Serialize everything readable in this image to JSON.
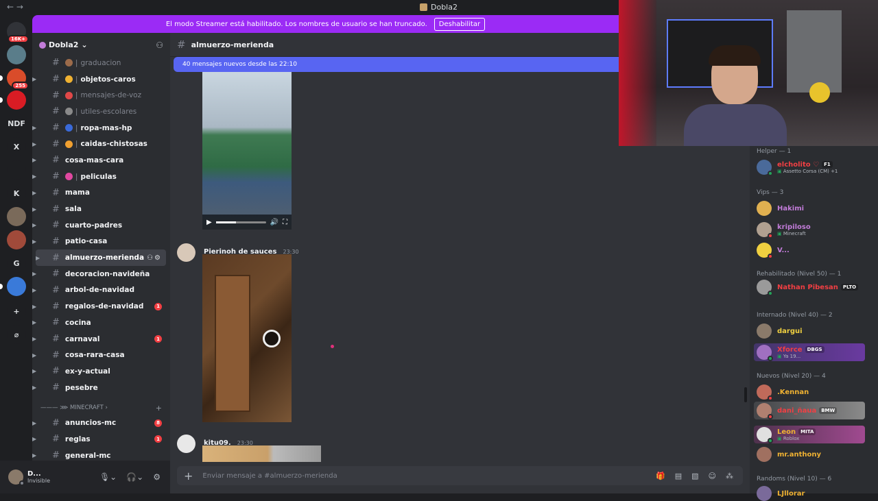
{
  "window": {
    "title": "Dobla2",
    "nav": "←  →"
  },
  "streamer_banner": {
    "text": "El modo Streamer está habilitado. Los nombres de usuario se han truncado.",
    "button": "Deshabilitar"
  },
  "servers": [
    {
      "label": "",
      "badge": "16K+",
      "color": "#313338"
    },
    {
      "label": "",
      "badge": "",
      "color": "#5a7d8a"
    },
    {
      "label": "",
      "badge": "255",
      "color": "#d94c2a"
    },
    {
      "label": "",
      "badge": "",
      "color": "#d91c24"
    },
    {
      "label": "NDF",
      "badge": "",
      "color": "#1e1f22"
    },
    {
      "label": "X",
      "badge": "",
      "color": "#1e1f22"
    },
    {
      "label": "",
      "badge": "",
      "color": "#1e1f22"
    },
    {
      "label": "K",
      "badge": "",
      "color": "#1e1f22"
    },
    {
      "label": "",
      "badge": "",
      "color": "#7a6a5a"
    },
    {
      "label": "",
      "badge": "",
      "color": "#a04a3a"
    },
    {
      "label": "G",
      "badge": "",
      "color": "#1e1f22"
    },
    {
      "label": "",
      "badge": "",
      "color": "#3a7ad9"
    },
    {
      "label": "+",
      "badge": "",
      "color": "#1e1f22"
    },
    {
      "label": "⌀",
      "badge": "",
      "color": "#1e1f22"
    }
  ],
  "guild": {
    "name": "Dobla2"
  },
  "channels": [
    {
      "name": "graduacion",
      "emoji_color": "#9c6b4a",
      "sep": true,
      "muted": true,
      "arrow": false,
      "unread": ""
    },
    {
      "name": "objetos-caros",
      "emoji_color": "#f0b232",
      "sep": true,
      "muted": false,
      "arrow": true,
      "unread": ""
    },
    {
      "name": "mensajes-de-voz",
      "emoji_color": "#e04848",
      "sep": true,
      "muted": true,
      "arrow": false,
      "unread": ""
    },
    {
      "name": "utiles-escolares",
      "emoji_color": "#8a8a8a",
      "sep": true,
      "muted": true,
      "arrow": false,
      "unread": ""
    },
    {
      "name": "ropa-mas-hp",
      "emoji_color": "#3a6ad9",
      "sep": true,
      "muted": false,
      "arrow": true,
      "unread": ""
    },
    {
      "name": "caidas-chistosas",
      "emoji_color": "#f0a030",
      "sep": true,
      "muted": false,
      "arrow": true,
      "unread": ""
    },
    {
      "name": "cosa-mas-cara",
      "emoji_color": "",
      "sep": false,
      "muted": false,
      "arrow": true,
      "unread": ""
    },
    {
      "name": "peliculas",
      "emoji_color": "#e048a0",
      "sep": true,
      "muted": false,
      "arrow": true,
      "unread": ""
    },
    {
      "name": "mama",
      "emoji_color": "",
      "sep": false,
      "muted": false,
      "arrow": true,
      "unread": ""
    },
    {
      "name": "sala",
      "emoji_color": "",
      "sep": false,
      "muted": false,
      "arrow": true,
      "unread": ""
    },
    {
      "name": "cuarto-padres",
      "emoji_color": "",
      "sep": false,
      "muted": false,
      "arrow": true,
      "unread": ""
    },
    {
      "name": "patio-casa",
      "emoji_color": "",
      "sep": false,
      "muted": false,
      "arrow": true,
      "unread": ""
    },
    {
      "name": "almuerzo-merienda",
      "emoji_color": "",
      "sep": false,
      "muted": false,
      "arrow": true,
      "unread": "",
      "active": true
    },
    {
      "name": "decoracion-navideña",
      "emoji_color": "",
      "sep": false,
      "muted": false,
      "arrow": true,
      "unread": ""
    },
    {
      "name": "arbol-de-navidad",
      "emoji_color": "",
      "sep": false,
      "muted": false,
      "arrow": true,
      "unread": ""
    },
    {
      "name": "regalos-de-navidad",
      "emoji_color": "",
      "sep": false,
      "muted": false,
      "arrow": true,
      "unread": "1"
    },
    {
      "name": "cocina",
      "emoji_color": "",
      "sep": false,
      "muted": false,
      "arrow": true,
      "unread": ""
    },
    {
      "name": "carnaval",
      "emoji_color": "",
      "sep": false,
      "muted": false,
      "arrow": true,
      "unread": "1"
    },
    {
      "name": "cosa-rara-casa",
      "emoji_color": "",
      "sep": false,
      "muted": false,
      "arrow": true,
      "unread": ""
    },
    {
      "name": "ex-y-actual",
      "emoji_color": "",
      "sep": false,
      "muted": false,
      "arrow": true,
      "unread": ""
    },
    {
      "name": "pesebre",
      "emoji_color": "",
      "sep": false,
      "muted": false,
      "arrow": true,
      "unread": ""
    }
  ],
  "category": {
    "name": "——— ⋙ MINECRAFT ›"
  },
  "channels_mc": [
    {
      "name": "anuncios-mc",
      "unread": "8"
    },
    {
      "name": "reglas",
      "unread": "1"
    },
    {
      "name": "general-mc",
      "unread": ""
    }
  ],
  "user": {
    "name": "D...",
    "status": "Invisible"
  },
  "chat": {
    "channel": "almuerzo-merienda",
    "new_messages": "40 mensajes nuevos desde las 22:10",
    "messages": [
      {
        "author": "Pierinoh de sauces",
        "time": "23:30"
      },
      {
        "author": "kitu09.",
        "time": "23:30"
      }
    ],
    "composer_placeholder": "Enviar mensaje a #almuerzo-merienda"
  },
  "members": {
    "groups": [
      {
        "title": "Helper — 1"
      },
      {
        "title": "Vips — 3"
      },
      {
        "title": "Rehabilitado (Nivel 50) — 1"
      },
      {
        "title": "Internado (Nivel 40) — 2"
      },
      {
        "title": "Nuevos (Nivel 20) — 4"
      },
      {
        "title": "Randoms (Nivel 10) — 6"
      }
    ],
    "list": [
      {
        "name": "elcholito ♡",
        "tag": "F1",
        "activity": "Assetto Corsa (CM) +1",
        "color": "#f23f43",
        "av": "#4a6a9a",
        "st": "#23a55a"
      },
      {
        "name": "Hakimi",
        "tag": "",
        "activity": "",
        "color": "#c27cd9",
        "av": "#e0b050",
        "st": ""
      },
      {
        "name": "kripiloso",
        "tag": "",
        "activity": "Minecraft",
        "color": "#c27cd9",
        "av": "#b0a090",
        "st": "#f23f43"
      },
      {
        "name": "V...",
        "tag": "",
        "activity": "",
        "color": "#c27cd9",
        "av": "#f0d040",
        "st": "#f23f43"
      },
      {
        "name": "Nathan Pibesan",
        "tag": "PLTO",
        "activity": "",
        "color": "#f23f43",
        "av": "#9a9a9a",
        "st": "#23a55a"
      },
      {
        "name": "dargui",
        "tag": "",
        "activity": "",
        "color": "#f0d040",
        "av": "#8a7a6a",
        "st": ""
      },
      {
        "name": "Xforce",
        "tag": "DBGS",
        "activity": "Ya 19...",
        "color": "#f23f43",
        "av": "#a070c0",
        "st": "#23a55a"
      },
      {
        "name": ".Kennan",
        "tag": "",
        "activity": "",
        "color": "#f0b232",
        "av": "#c06a5a",
        "st": "#f23f43"
      },
      {
        "name": "dani_ñaua",
        "tag": "BMW",
        "activity": "",
        "color": "#f23f43",
        "av": "#b08070",
        "st": "#f23f43"
      },
      {
        "name": "Leon",
        "tag": "MITA",
        "activity": "Roblox",
        "color": "#f0b232",
        "av": "#e0e0e0",
        "st": "#23a55a"
      },
      {
        "name": "mr.anthony",
        "tag": "",
        "activity": "",
        "color": "#f0b232",
        "av": "#a07060",
        "st": ""
      },
      {
        "name": "LJllorar",
        "tag": "",
        "activity": "",
        "color": "#f0b232",
        "av": "#7a6a9a",
        "st": ""
      }
    ]
  }
}
